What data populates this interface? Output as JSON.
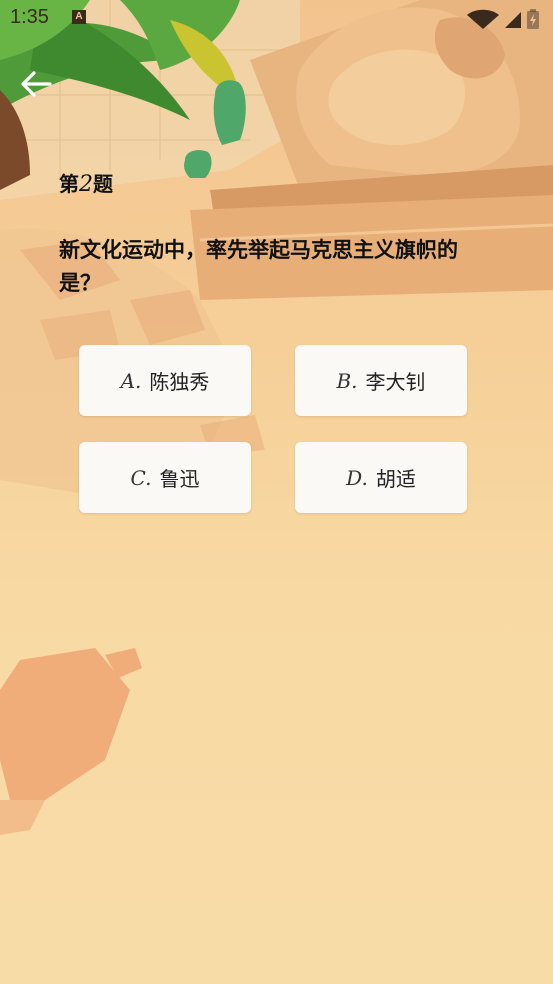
{
  "status_bar": {
    "time": "1:35",
    "app_icon_letter": "A",
    "icons": [
      "wifi-icon",
      "cellular-signal-icon",
      "battery-charging-icon"
    ]
  },
  "nav": {
    "back_icon": "arrow-left-icon"
  },
  "question": {
    "prefix": "第",
    "number": "2",
    "suffix": "题",
    "text": "新文化运动中，率先举起马克思主义旗帜的是？"
  },
  "options": [
    {
      "letter": "A.",
      "text": "陈独秀"
    },
    {
      "letter": "B.",
      "text": "李大钊"
    },
    {
      "letter": "C.",
      "text": "鲁迅"
    },
    {
      "letter": "D.",
      "text": "胡适"
    }
  ],
  "colors": {
    "background_top": "#f3c38e",
    "background_bottom": "#f8dca8",
    "option_bg": "#fbf9f5",
    "text": "#111111",
    "palm_leaf": "#4f9b3a",
    "stone": "#e9b27c"
  }
}
